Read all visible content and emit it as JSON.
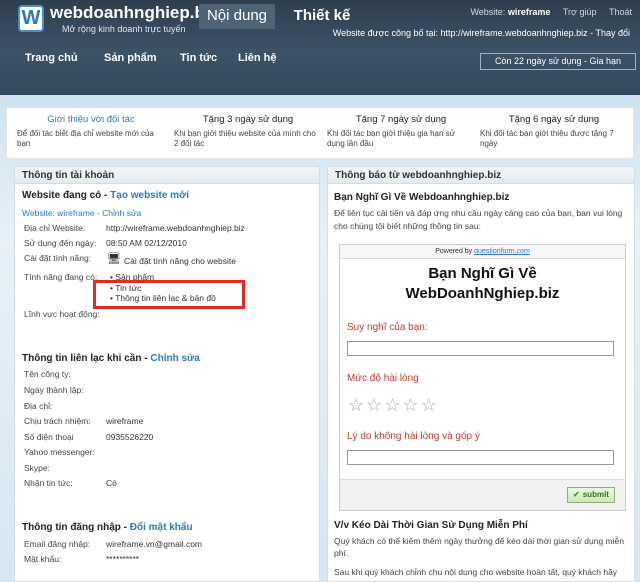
{
  "brand": {
    "logo_letter": "W",
    "title": "webdoanhnghiep.biz",
    "subtitle": "Mở rộng kinh doanh trực tuyến"
  },
  "top_tabs": [
    {
      "label": "Nội dung",
      "active": true
    },
    {
      "label": "Thiết kế",
      "active": false
    }
  ],
  "top_links": {
    "website_label": "Website:",
    "website_name": "wireframe",
    "help": "Trợ giúp",
    "logout": "Thoát"
  },
  "publish": {
    "text": "Website được công bố tại: http://wireframe.webdoanhnghiep.biz - Thay đổi"
  },
  "nav": [
    "Trang chủ",
    "Sản phẩm",
    "Tin tức",
    "Liên hệ"
  ],
  "remaining": "Còn 22 ngày sử dụng - Gia hạn",
  "promos": [
    {
      "title": "Giới thiệu với đối tác",
      "desc": "Để đối tác biết địa chỉ website mới của bạn"
    },
    {
      "title": "Tặng 3 ngày sử dụng",
      "desc": "Khi bạn giới thiệu website của mình cho 2 đối tác"
    },
    {
      "title": "Tặng 7 ngày sử dụng",
      "desc": "Khi đối tác bạn giới thiệu gia hạn sử dụng lần đầu"
    },
    {
      "title": "Tặng 6 ngày sử dụng",
      "desc": "Khi đối tác bạn giới thiệu được tặng 7 ngày"
    }
  ],
  "account": {
    "heading": "Thông tin tài khoản",
    "website": {
      "heading": "Website đang có",
      "create": "Tạo website mới",
      "site_label": "Website: wireframe",
      "edit": "Chỉnh sửa",
      "rows": [
        {
          "label": "Địa chỉ Website:",
          "value": "http://wireframe.webdoanhnghiep.biz"
        },
        {
          "label": "Sử dụng đến ngày:",
          "value": "08:50 AM 02/12/2010"
        },
        {
          "label": "Cài đặt tính năng:",
          "value": "Cài đặt tính năng cho website"
        }
      ],
      "features_label": "Tính năng đang có:",
      "features": [
        "Sản phẩm",
        "Tin tức",
        "Thông tin liên lạc & bản đồ"
      ],
      "field_label": "Lĩnh vực hoạt động:"
    },
    "contact": {
      "heading": "Thông tin liên lạc khi cần",
      "edit": "Chỉnh sửa",
      "rows": [
        {
          "label": "Tên công ty:",
          "value": ""
        },
        {
          "label": "Ngày thành lập:",
          "value": ""
        },
        {
          "label": "Địa chỉ:",
          "value": ""
        },
        {
          "label": "Chịu trách nhiệm:",
          "value": "wireframe"
        },
        {
          "label": "Số điện thoại",
          "value": "0935526220"
        },
        {
          "label": "Yahoo messenger:",
          "value": ""
        },
        {
          "label": "Skype:",
          "value": ""
        },
        {
          "label": "Nhận tin tức:",
          "value": "Có"
        }
      ]
    },
    "login": {
      "heading": "Thông tin đăng nhập",
      "change_pw": "Đổi mật khẩu",
      "rows": [
        {
          "label": "Email đăng nhập:",
          "value": "wireframe.vn@gmail.com"
        },
        {
          "label": "Mật khẩu:",
          "value": "**********"
        }
      ]
    }
  },
  "notice": {
    "heading": "Thông báo từ webdoanhnghiep.biz",
    "survey_title": "Bạn Nghĩ Gì Về Webdoanhnghiep.biz",
    "survey_desc": "Để liên tục cải tiến và đáp ứng nhu cầu ngày càng cao của bạn, ban vui lòng cho chúng tôi biết những thông tin sau:",
    "form": {
      "powered_by": "Powered by",
      "powered_link": "questionform.com",
      "title_line1": "Bạn Nghĩ Gì Về",
      "title_line2": "WebDoanhNghiep.biz",
      "q1": "Suy nghĩ của bạn:",
      "q2": "Mức độ hài lòng",
      "q3": "Lý do không hài lòng và góp ý",
      "stars": 5,
      "submit": "submit"
    },
    "news_title": "V/v Kéo Dài Thời Gian Sử Dụng Miễn Phí",
    "news_p1": "Quý khách có thể kiếm thêm ngày thưởng để kéo dài thời gian sử dụng miễn phí.",
    "news_p2": "Sau khi quý khách chỉnh chu nội dung cho website hoàn tất, quý khách hãy"
  },
  "colors": {
    "header": "#34495c",
    "link": "#2a7ac0",
    "highlight": "#e32b24",
    "question": "#c0392b"
  }
}
